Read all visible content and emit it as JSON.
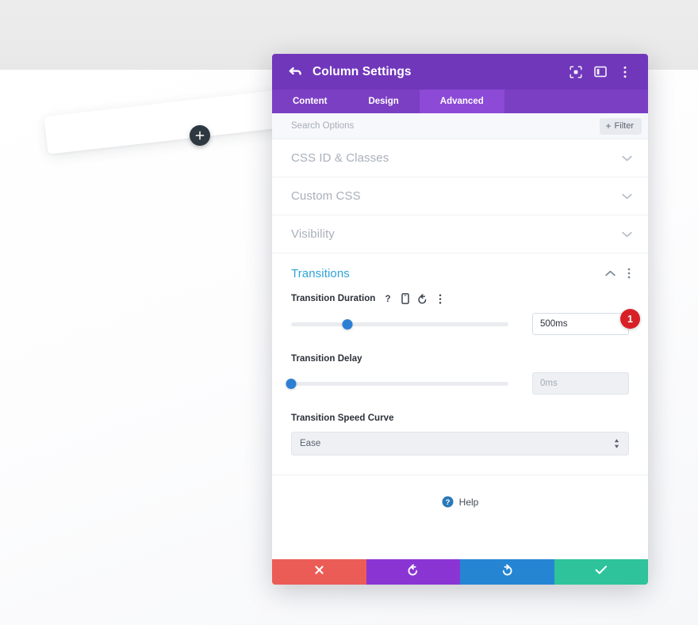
{
  "canvas": {
    "add_module_icon": "plus-icon",
    "module_bar_label": ""
  },
  "modal": {
    "title": "Column Settings",
    "back_icon": "back-arrow-icon",
    "header_tools": [
      {
        "name": "focus-target-icon",
        "label": ""
      },
      {
        "name": "layout-columns-icon",
        "label": ""
      },
      {
        "name": "vertical-dots-icon",
        "label": ""
      }
    ],
    "tabs": [
      {
        "label": "Content",
        "active": false
      },
      {
        "label": "Design",
        "active": false
      },
      {
        "label": "Advanced",
        "active": true
      }
    ],
    "search": {
      "placeholder": "Search Options",
      "value": ""
    },
    "filter": {
      "plus": "+",
      "label": "Filter"
    },
    "accordions": [
      {
        "title": "CSS ID & Classes",
        "open": false
      },
      {
        "title": "Custom CSS",
        "open": false
      },
      {
        "title": "Visibility",
        "open": false
      }
    ],
    "open_section": {
      "title": "Transitions",
      "collapse_icon": "chevron-up-icon",
      "menu_icon": "vertical-dots-icon",
      "fields": [
        {
          "label": "Transition Duration",
          "icons": [
            "help-question-icon",
            "mobile-device-icon",
            "reset-undo-icon",
            "vertical-dots-icon"
          ],
          "value": "500ms",
          "placeholder": "",
          "focused": true,
          "slider_percent": 26
        },
        {
          "label": "Transition Delay",
          "icons": [],
          "value": "",
          "placeholder": "0ms",
          "focused": false,
          "slider_percent": 0
        }
      ],
      "select_field": {
        "label": "Transition Speed Curve",
        "value": "Ease",
        "arrows_icon": "stepper-arrows-icon"
      }
    },
    "step_badge": "1",
    "help": {
      "icon": "help-circle-icon",
      "label": "Help"
    },
    "footer_buttons": [
      {
        "name": "cancel-button",
        "icon": "close-x-icon",
        "class": "cancel"
      },
      {
        "name": "undo-button",
        "icon": "undo-arrow-icon",
        "class": "undo"
      },
      {
        "name": "redo-button",
        "icon": "redo-arrow-icon",
        "class": "redo"
      },
      {
        "name": "save-button",
        "icon": "checkmark-icon",
        "class": "save"
      }
    ]
  },
  "colors": {
    "header_purple": "#7037bb",
    "tab_purple": "#7b3fc4",
    "tab_active_purple": "#8c4ad6",
    "accent_blue": "#2ea3d8",
    "slider_blue": "#2d7fd4",
    "badge_red": "#d81f26",
    "cancel_red": "#ec5c57",
    "undo_purple": "#8b34d4",
    "redo_blue": "#2585d3",
    "save_green": "#2ec39b"
  }
}
